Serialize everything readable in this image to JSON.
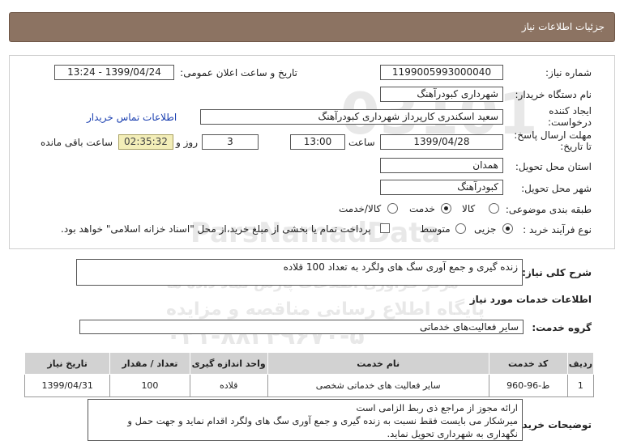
{
  "header": {
    "title": "جزئیات اطلاعات نیاز"
  },
  "fields": {
    "need_number_label": "شماره نیاز:",
    "need_number": "1199005993000040",
    "announce_label": "تاریخ و ساعت اعلان عمومی:",
    "announce_value": "1399/04/24 - 13:24",
    "buyer_org_label": "نام دستگاه خریدار:",
    "buyer_org": "شهرداری کبودرآهنگ",
    "creator_label": "ایجاد کننده درخواست:",
    "creator": "سعید اسکندری کارپرداز شهرداری کبودرآهنگ",
    "contact_link": "اطلاعات تماس خریدار",
    "deadline_label": "مهلت ارسال پاسخ: تا تاریخ:",
    "deadline_date": "1399/04/28",
    "time_label": "ساعت",
    "deadline_time": "13:00",
    "days_value": "3",
    "days_label": "روز و",
    "remaining_value": "02:35:32",
    "remaining_label": "ساعت باقی مانده",
    "province_label": "استان محل تحویل:",
    "province": "همدان",
    "city_label": "شهر محل تحویل:",
    "city": "کبودرآهنگ",
    "category_label": "طبقه بندی موضوعی:",
    "category_options": [
      "کالا",
      "خدمت",
      "کالا/خدمت"
    ],
    "category_selected": "خدمت",
    "process_label": "نوع فرآیند خرید :",
    "process_options": [
      "جزیی",
      "متوسط"
    ],
    "process_selected": "جزیی",
    "payment_note": "پرداخت تمام یا بخشی از مبلغ خرید،از محل \"اسناد خزانه اسلامی\" خواهد بود."
  },
  "summary": {
    "label": "شرح کلی نیاز:",
    "value": "زنده گیری و جمع آوری سگ های ولگرد به تعداد 100 قلاده"
  },
  "services_section": {
    "title": "اطلاعات خدمات مورد نیاز"
  },
  "service_group": {
    "label": "گروه خدمت:",
    "value": "سایر فعالیت‌های خدماتی"
  },
  "table": {
    "headers": [
      "ردیف",
      "کد خدمت",
      "نام خدمت",
      "واحد اندازه گیری",
      "تعداد / مقدار",
      "تاریخ نیاز"
    ],
    "rows": [
      [
        "1",
        "ط-96-960",
        "سایر فعالیت های خدماتی شخصی",
        "قلاده",
        "100",
        "1399/04/31"
      ]
    ]
  },
  "buyer_notes": {
    "label": "توضیحات خریدار:",
    "lines": [
      "ارائه مجوز از مراجع ذی ربط الزامی است",
      "میرشکار می بایست فقط نسبت به زنده گیری و جمع آوری سگ های ولگرد اقدام نماید و جهت حمل و",
      "نگهداری به شهرداری تحویل نماید."
    ]
  },
  "watermark": {
    "line1": "ParsNamadData",
    "line2": "مرکز فراوری اطلاعات پارس نماد داده ها",
    "line3": "پایگاه اطلاع رسانی مناقصه و مزایده",
    "line4": "۰۲۱-۸۸۳۴۹۶۷۰-۵",
    "digits": "03101"
  }
}
